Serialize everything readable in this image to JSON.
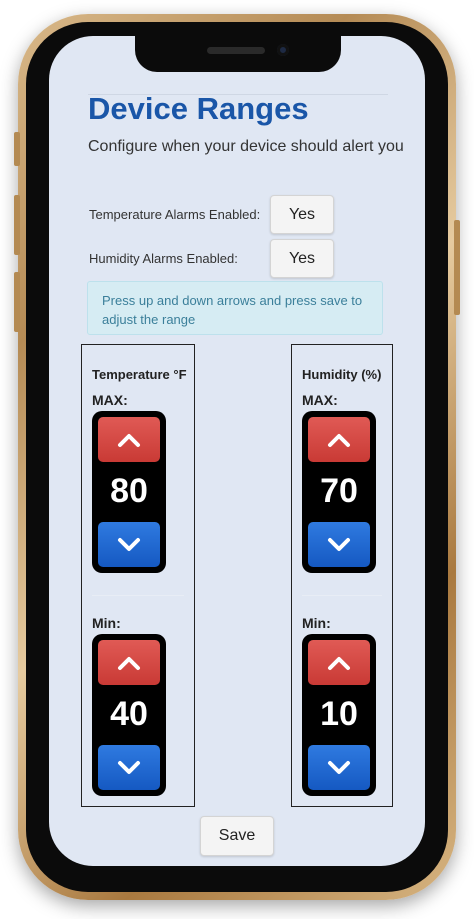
{
  "page": {
    "title": "Device Ranges",
    "subtitle": "Configure when your device should alert you"
  },
  "alarms": {
    "temperature_label": "Temperature Alarms Enabled:",
    "temperature_value": "Yes",
    "humidity_label": "Humidity Alarms Enabled:",
    "humidity_value": "Yes"
  },
  "info_text": "Press up and down arrows and press save to adjust the range",
  "temperature": {
    "title": "Temperature °F",
    "max_label": "MAX:",
    "max_value": "80",
    "min_label": "Min:",
    "min_value": "40"
  },
  "humidity": {
    "title": "Humidity (%)",
    "max_label": "MAX:",
    "max_value": "70",
    "min_label": "Min:",
    "min_value": "10"
  },
  "save_label": "Save",
  "colors": {
    "title": "#1a56a8",
    "up_arrow": "#d8443f",
    "down_arrow": "#1f6ad6",
    "info_bg": "#d6ecf3",
    "screen_bg": "#e0e7f3"
  },
  "icons": {
    "up": "chevron-up-icon",
    "down": "chevron-down-icon"
  }
}
